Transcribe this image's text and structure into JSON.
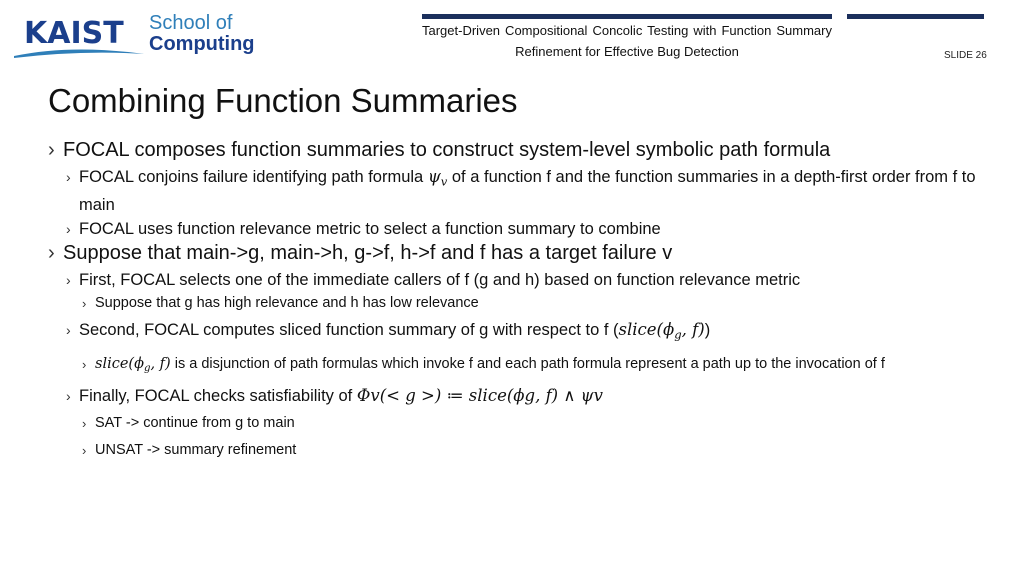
{
  "header": {
    "logo": {
      "brand": "KAIST",
      "school_line1": "School of",
      "school_line2": "Computing"
    },
    "paper_title": "Target-Driven Compositional Concolic Testing with Function Summary Refinement for Effective Bug Detection",
    "slide_number": "SLIDE 26",
    "colors": {
      "brand_blue": "#1b3f8c",
      "accent_blue": "#2f7fb9",
      "bar": "#1b2f5c"
    }
  },
  "slide": {
    "title": "Combining Function Summaries",
    "bullets": [
      {
        "level": 1,
        "text": "FOCAL composes function summaries to construct system-level symbolic path formula"
      },
      {
        "level": 2,
        "pre": "FOCAL conjoins failure identifying path formula ",
        "math": "ψ",
        "math_sub": "v",
        "post": " of a function f and the function summaries in a depth-first order from f to main"
      },
      {
        "level": 2,
        "text": "FOCAL uses function relevance metric to select a function summary to combine"
      },
      {
        "level": 1,
        "text": "Suppose that main->g, main->h, g->f, h->f and f has a target failure v"
      },
      {
        "level": 2,
        "text": "First, FOCAL selects one of the immediate callers of f (g and h) based on function relevance metric"
      },
      {
        "level": 3,
        "text": "Suppose that g has high relevance and h has low relevance"
      },
      {
        "level": 2,
        "pre": "Second, FOCAL computes sliced function summary of g with respect to f (",
        "math": "slice(ϕ",
        "math_sub": "g",
        "math_post": ", f)",
        "post": ")"
      },
      {
        "level": 3,
        "math": "slice(ϕ",
        "math_sub": "g",
        "math_post": ", f)",
        "post": " is a disjunction of path formulas which invoke f and each path formula represent a path up to the invocation of f"
      },
      {
        "level": 2,
        "pre": "Finally, FOCAL checks satisfiability of ",
        "formula": "Φv(< g >) ≔ slice(ϕg, f) ∧ ψv"
      },
      {
        "level": 3,
        "text": "SAT -> continue from g to main"
      },
      {
        "level": 3,
        "text": "UNSAT -> summary refinement"
      }
    ],
    "bullet_glyph": "›"
  }
}
